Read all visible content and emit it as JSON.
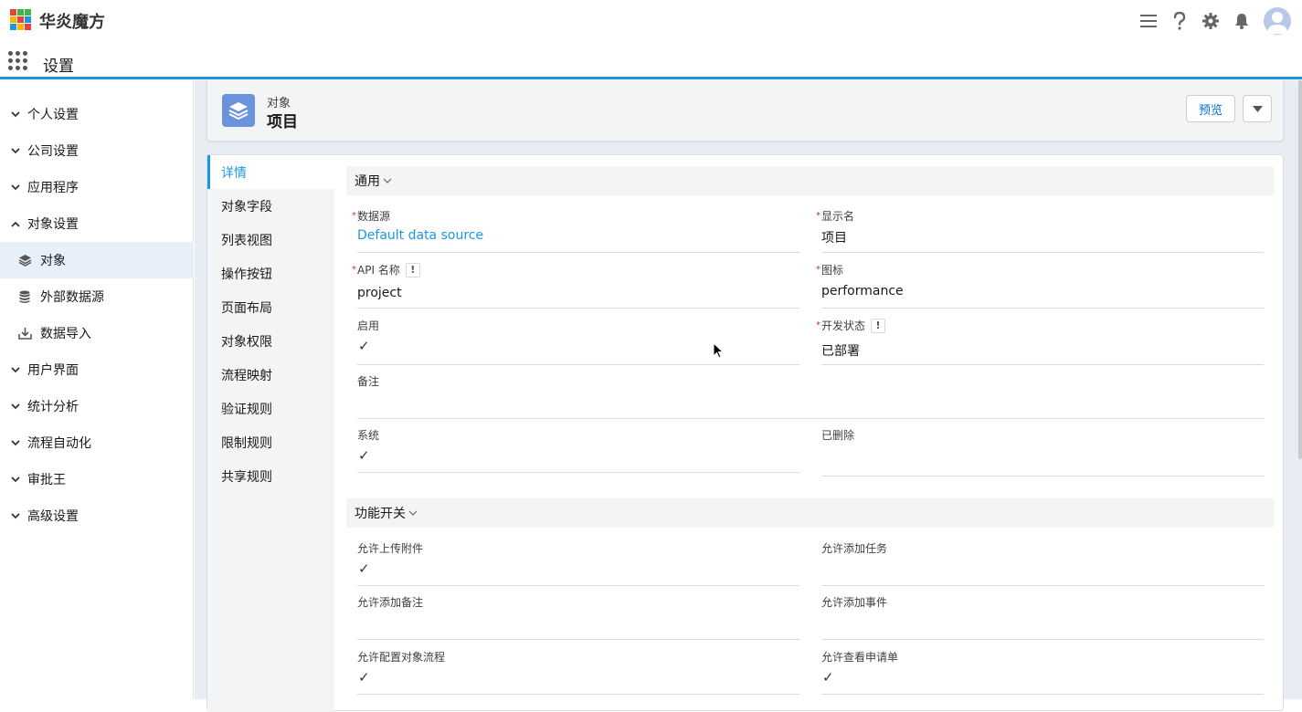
{
  "header": {
    "brand": "华炎魔方",
    "logo_colors": [
      "#e8413a",
      "#f7b500",
      "#3fb549",
      "#1b96e5"
    ],
    "icons": [
      "menu-icon",
      "help-icon",
      "gear-icon",
      "bell-icon",
      "avatar"
    ]
  },
  "appbar": {
    "title": "设置"
  },
  "sidebar": {
    "items": [
      {
        "label": "个人设置",
        "icon": "chevron-down"
      },
      {
        "label": "公司设置",
        "icon": "chevron-down"
      },
      {
        "label": "应用程序",
        "icon": "chevron-down"
      },
      {
        "label": "对象设置",
        "icon": "chevron-up"
      },
      {
        "label": "对象",
        "icon": "layers-icon",
        "active": true
      },
      {
        "label": "外部数据源",
        "icon": "database-icon"
      },
      {
        "label": "数据导入",
        "icon": "download-icon"
      },
      {
        "label": "用户界面",
        "icon": "chevron-down"
      },
      {
        "label": "统计分析",
        "icon": "chevron-down"
      },
      {
        "label": "流程自动化",
        "icon": "chevron-down"
      },
      {
        "label": "审批王",
        "icon": "chevron-down"
      },
      {
        "label": "高级设置",
        "icon": "chevron-down"
      }
    ]
  },
  "object": {
    "type_label": "对象",
    "name": "项目",
    "preview_label": "预览"
  },
  "tabs": [
    "详情",
    "对象字段",
    "列表视图",
    "操作按钮",
    "页面布局",
    "对象权限",
    "流程映射",
    "验证规则",
    "限制规则",
    "共享规则"
  ],
  "sections": {
    "general": "通用",
    "features": "功能开关"
  },
  "fields": {
    "datasource_label": "数据源",
    "datasource_value": "Default data source",
    "display_name_label": "显示名",
    "display_name_value": "项目",
    "api_name_label": "API 名称",
    "api_name_value": "project",
    "icon_label": "图标",
    "icon_value": "performance",
    "enabled_label": "启用",
    "dev_status_label": "开发状态",
    "dev_status_value": "已部署",
    "remark_label": "备注",
    "system_label": "系统",
    "deleted_label": "已删除",
    "allow_attach_label": "允许上传附件",
    "allow_task_label": "允许添加任务",
    "allow_note_label": "允许添加备注",
    "allow_event_label": "允许添加事件",
    "allow_flow_label": "允许配置对象流程",
    "allow_request_label": "允许查看申请单",
    "check_mark": "✓",
    "info_mark": "!"
  }
}
